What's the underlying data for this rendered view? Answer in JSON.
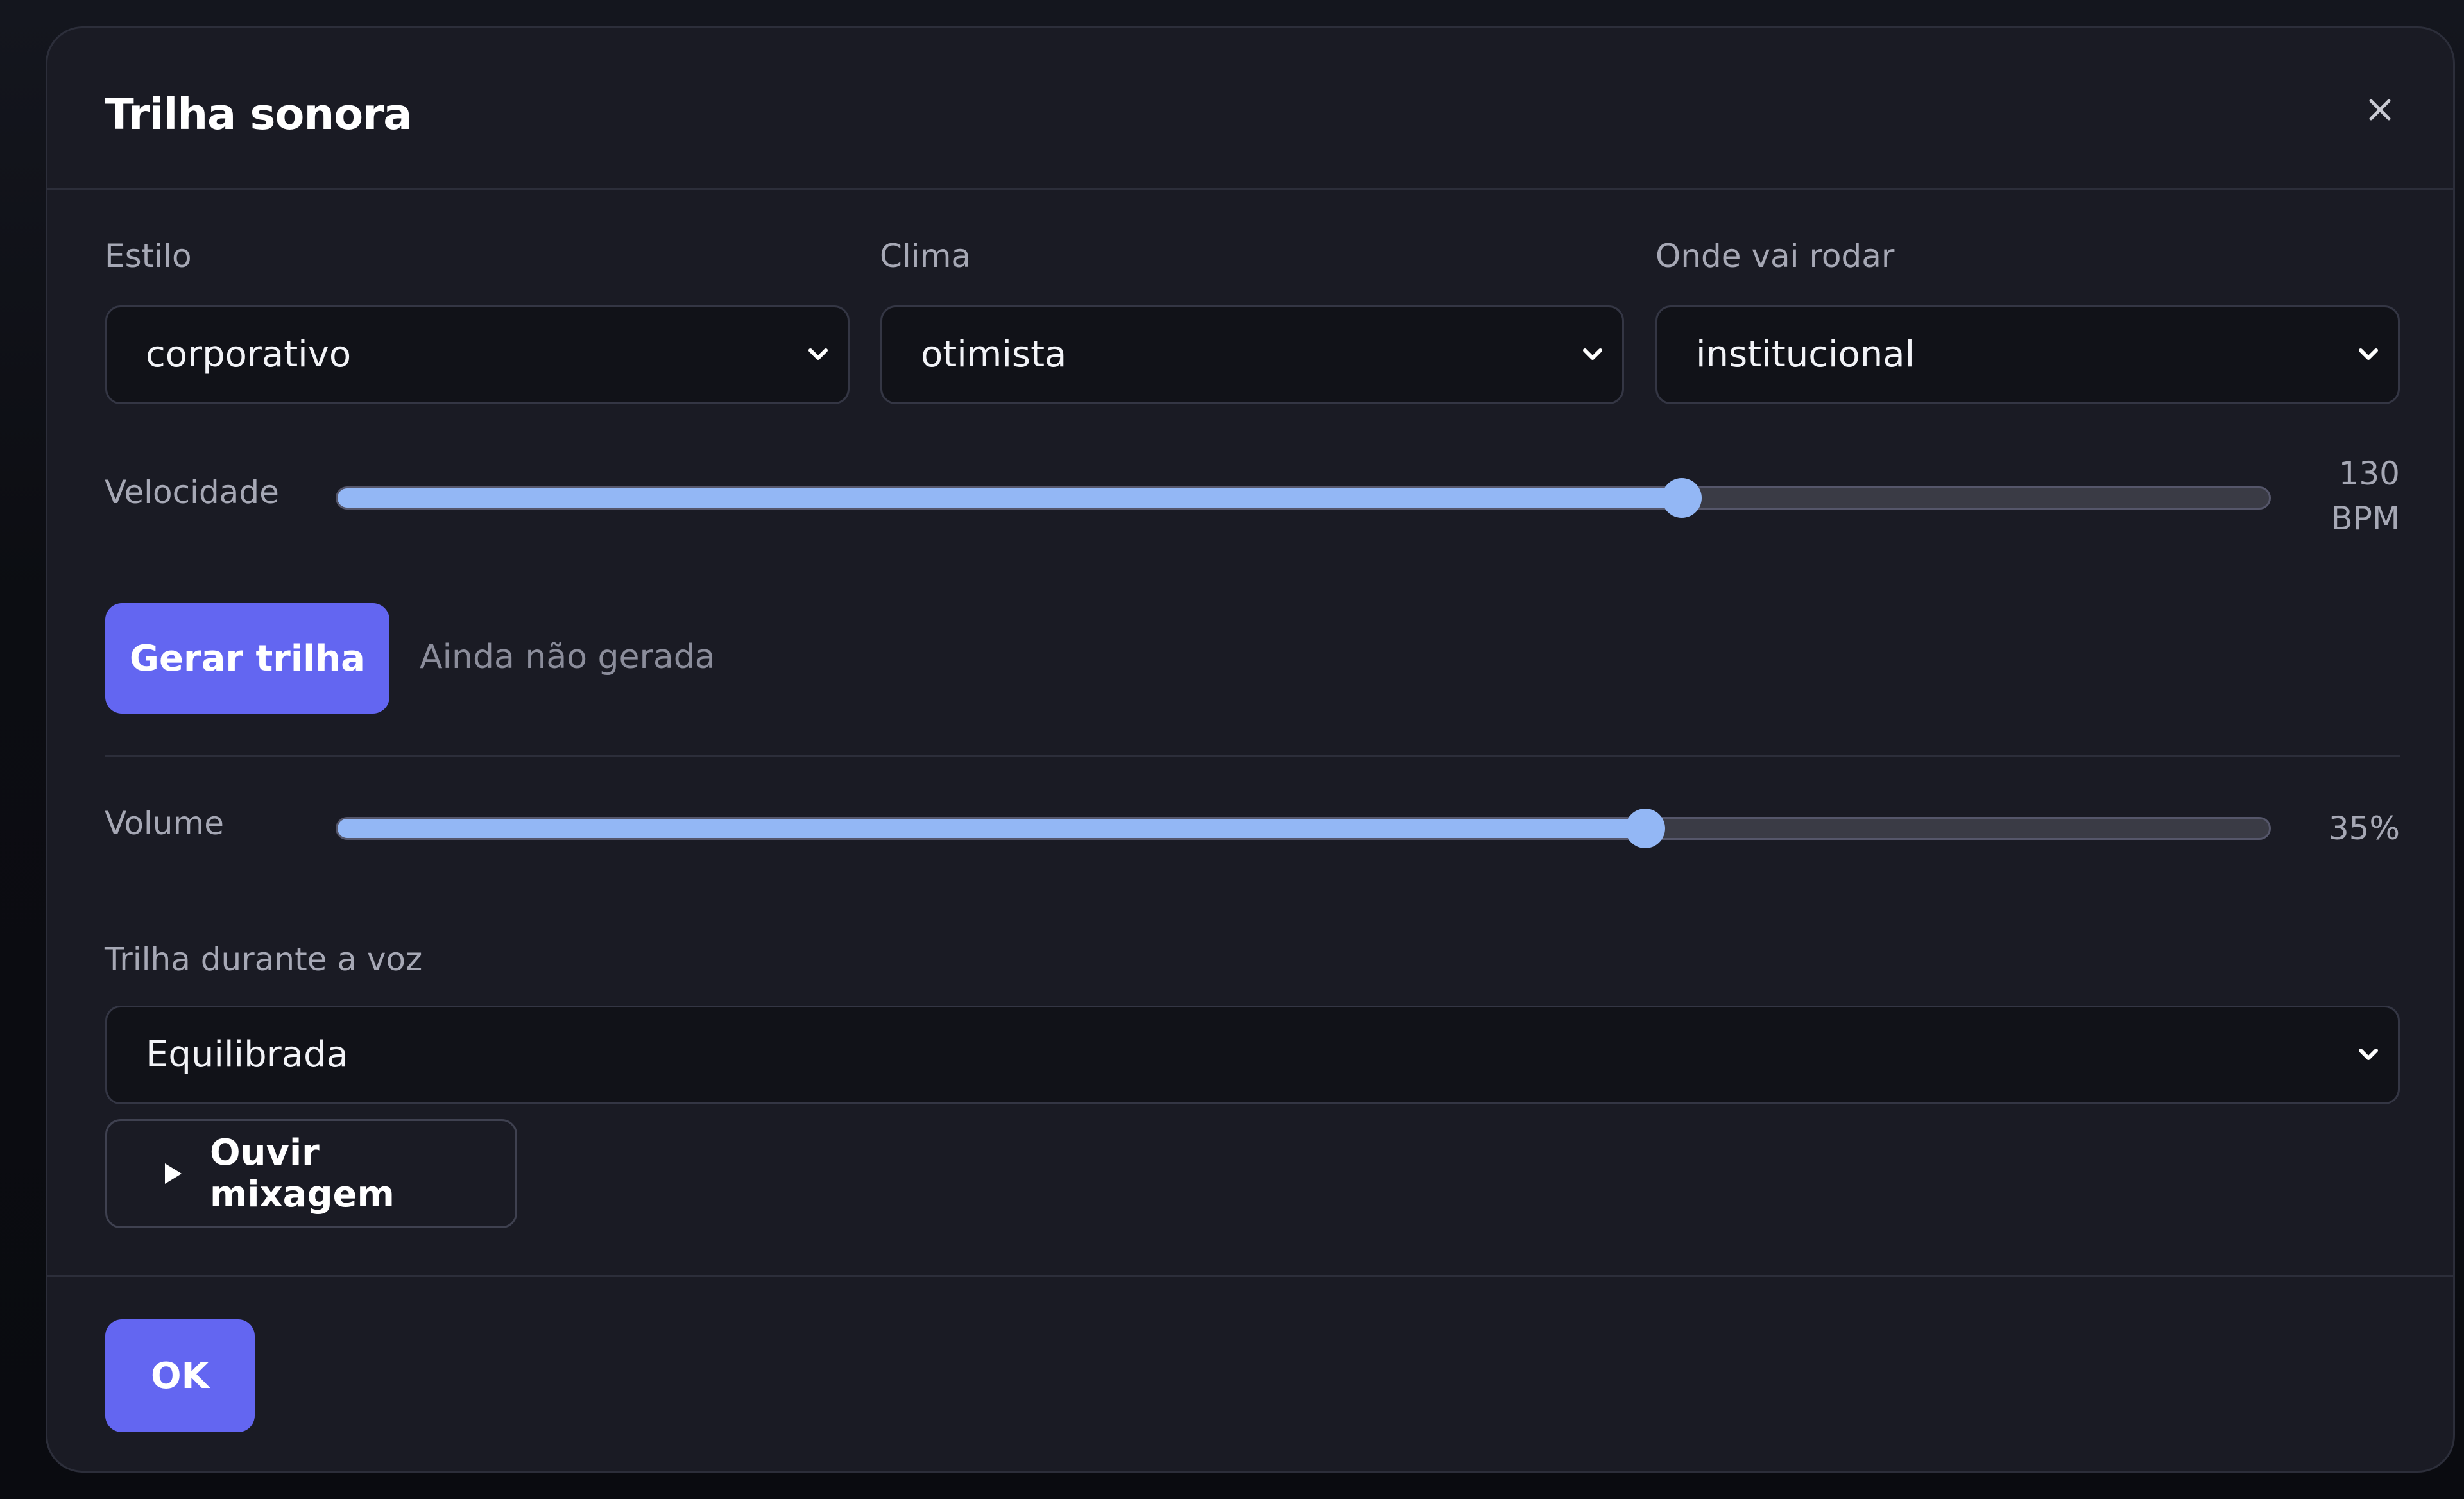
{
  "dialog": {
    "title": "Trilha sonora",
    "close_icon": "close-icon"
  },
  "fields": {
    "estilo": {
      "label": "Estilo",
      "value": "corporativo"
    },
    "clima": {
      "label": "Clima",
      "value": "otimista"
    },
    "onde": {
      "label": "Onde vai rodar",
      "value": "institucional"
    }
  },
  "velocidade": {
    "label": "Velocidade",
    "value": 130,
    "value_text": "130",
    "unit": "BPM",
    "fraction": 0.696
  },
  "generate": {
    "button_label": "Gerar trilha",
    "status": "Ainda não gerada"
  },
  "volume": {
    "label": "Volume",
    "value_text": "35%",
    "fraction": 0.677
  },
  "ducking": {
    "label": "Trilha durante a voz",
    "value": "Equilibrada"
  },
  "preview": {
    "button_label": "Ouvir mixagem",
    "icon": "play-icon"
  },
  "footer": {
    "ok_label": "OK"
  },
  "colors": {
    "accent": "#6366f1",
    "slider": "#93b7f5",
    "surface": "#1a1b24"
  }
}
